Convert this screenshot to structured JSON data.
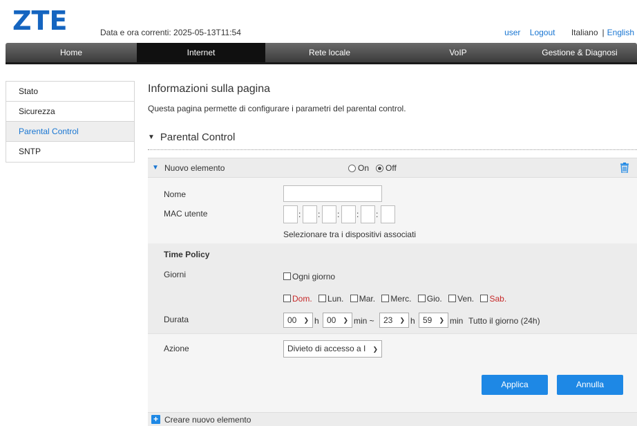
{
  "header": {
    "logo": "ZTE",
    "datetime": "Data e ora correnti: 2025-05-13T11:54",
    "user": "user",
    "logout": "Logout",
    "lang_it": "Italiano",
    "lang_sep": "|",
    "lang_en": "English"
  },
  "nav": {
    "tabs": [
      {
        "label": "Home",
        "active": false
      },
      {
        "label": "Internet",
        "active": true
      },
      {
        "label": "Rete locale",
        "active": false
      },
      {
        "label": "VoIP",
        "active": false
      },
      {
        "label": "Gestione & Diagnosi",
        "active": false
      }
    ]
  },
  "sidebar": {
    "items": [
      {
        "label": "Stato",
        "active": false
      },
      {
        "label": "Sicurezza",
        "active": false
      },
      {
        "label": "Parental Control",
        "active": true
      },
      {
        "label": "SNTP",
        "active": false
      }
    ]
  },
  "main": {
    "title": "Informazioni sulla pagina",
    "description": "Questa pagina permette di configurare i parametri del parental control.",
    "section_title": "Parental Control",
    "item": {
      "title": "Nuovo elemento",
      "radio_on": "On",
      "radio_off": "Off",
      "selected": "Off"
    },
    "form": {
      "name_label": "Nome",
      "name_value": "",
      "mac_label": "MAC utente",
      "select_devices_link": "Selezionare tra i dispositivi associati",
      "time_policy_label": "Time Policy",
      "days_label": "Giorni",
      "every_day": "Ogni giorno",
      "days": [
        "Dom.",
        "Lun.",
        "Mar.",
        "Merc.",
        "Gio.",
        "Ven.",
        "Sab."
      ],
      "duration_label": "Durata",
      "start_hour": "00",
      "start_min": "00",
      "end_hour": "23",
      "end_min": "59",
      "unit_h": "h",
      "unit_min": "min",
      "unit_min_tilde": "min ~",
      "all_day_link": "Tutto il giorno (24h)",
      "action_label": "Azione",
      "action_value": "Divieto di accesso a I"
    },
    "buttons": {
      "apply": "Applica",
      "cancel": "Annulla"
    },
    "create_new": "Creare nuovo elemento"
  },
  "colors": {
    "accent": "#1976d2",
    "button": "#1e88e5",
    "weekend": "#c62828",
    "nav_active": "#101010"
  }
}
